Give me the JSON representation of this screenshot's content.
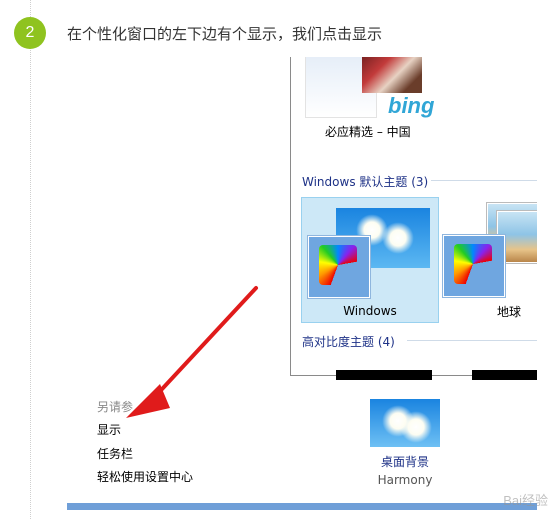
{
  "step": {
    "number": "2",
    "instruction": "在个性化窗口的左下边有个显示，我们点击显示"
  },
  "window": {
    "bing_theme": {
      "logo_text": "bing",
      "name": "必应精选 – 中国"
    },
    "default_group": {
      "title": "Windows 默认主题 (3)",
      "themes": [
        {
          "name": "Windows",
          "selected": true
        },
        {
          "name": "地球",
          "selected": false
        }
      ]
    },
    "high_contrast_group": {
      "title": "高对比度主题 (4)"
    },
    "see_also": {
      "heading": "另请参",
      "links": [
        "显示",
        "任务栏",
        "轻松使用设置中心"
      ]
    },
    "desktop_background": {
      "label": "桌面背景",
      "value": "Harmony"
    }
  },
  "watermark": "Bai经验",
  "colors": {
    "step_badge": "#8fc31f",
    "arrow": "#e01b1b",
    "group_title": "#1e3287",
    "selection": "#cde8f7"
  }
}
